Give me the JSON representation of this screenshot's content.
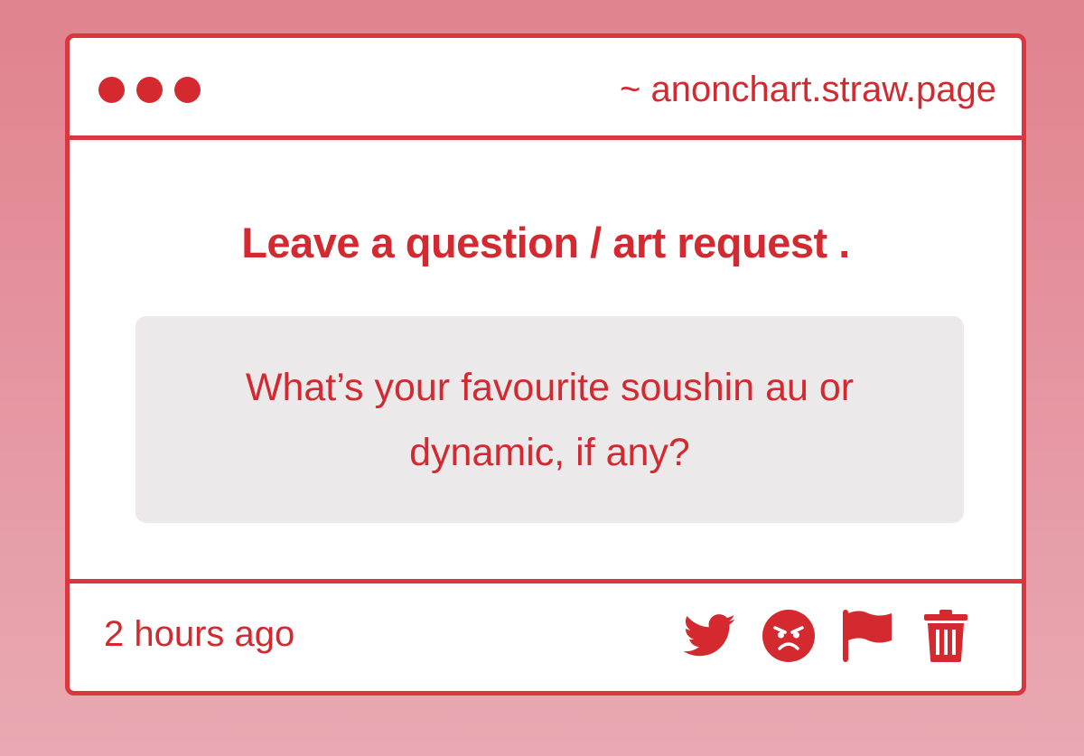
{
  "window": {
    "url": "~ anonchart.straw.page"
  },
  "content": {
    "heading": "Leave a question / art request .",
    "question": "What’s your favourite soushin au or dynamic, if any?"
  },
  "footer": {
    "timestamp": "2 hours ago",
    "actions": [
      {
        "icon": "twitter-bird-icon"
      },
      {
        "icon": "angry-face-icon"
      },
      {
        "icon": "flag-icon"
      },
      {
        "icon": "trash-icon"
      }
    ]
  },
  "colors": {
    "accent": "#d22a30",
    "background_top": "#e0828f",
    "background_bottom": "#e9a9b2",
    "question_box": "#ebe9ea"
  }
}
